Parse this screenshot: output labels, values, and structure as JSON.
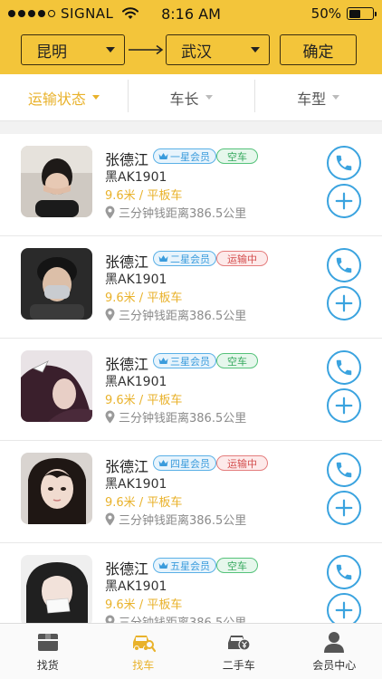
{
  "status_bar": {
    "carrier": "SIGNAL",
    "time": "8:16 AM",
    "battery": "50%",
    "battery_level": 0.5,
    "icons": [
      "signal-dots-icon",
      "wifi-icon",
      "battery-icon"
    ]
  },
  "route": {
    "from": "昆明",
    "to": "武汉",
    "confirm_label": "确定"
  },
  "filters": [
    {
      "label": "运输状态",
      "active": true
    },
    {
      "label": "车长",
      "active": false
    },
    {
      "label": "车型",
      "active": false
    }
  ],
  "drivers": [
    {
      "name": "张德江",
      "member": "一星会员",
      "status": "空车",
      "status_type": "idle",
      "plate": "黑AK1901",
      "spec": "9.6米 / 平板车",
      "location": "三分钟钱距离386.5公里"
    },
    {
      "name": "张德江",
      "member": "二星会员",
      "status": "运输中",
      "status_type": "busy",
      "plate": "黑AK1901",
      "spec": "9.6米 / 平板车",
      "location": "三分钟钱距离386.5公里"
    },
    {
      "name": "张德江",
      "member": "三星会员",
      "status": "空车",
      "status_type": "idle",
      "plate": "黑AK1901",
      "spec": "9.6米 / 平板车",
      "location": "三分钟钱距离386.5公里"
    },
    {
      "name": "张德江",
      "member": "四星会员",
      "status": "运输中",
      "status_type": "busy",
      "plate": "黑AK1901",
      "spec": "9.6米 / 平板车",
      "location": "三分钟钱距离386.5公里"
    },
    {
      "name": "张德江",
      "member": "五星会员",
      "status": "空车",
      "status_type": "idle",
      "plate": "黑AK1901",
      "spec": "9.6米 / 平板车",
      "location": "三分钟钱距离386.5公里"
    }
  ],
  "tabbar": [
    {
      "label": "找货",
      "icon": "cargo-box-icon",
      "active": false
    },
    {
      "label": "找车",
      "icon": "truck-search-icon",
      "active": true
    },
    {
      "label": "二手车",
      "icon": "used-car-icon",
      "active": false
    },
    {
      "label": "会员中心",
      "icon": "user-icon",
      "active": false
    }
  ],
  "colors": {
    "header_yellow": "#f3c53a",
    "accent_gold": "#e9b22b",
    "action_blue": "#3aa3df",
    "idle_green": "#35a85d",
    "busy_red": "#d44f4f"
  }
}
